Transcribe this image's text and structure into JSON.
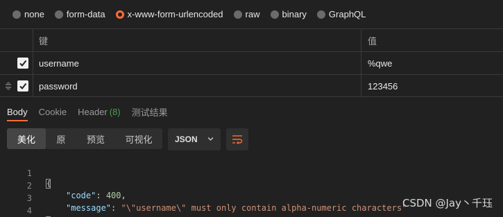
{
  "body_types": [
    {
      "label": "none",
      "selected": false
    },
    {
      "label": "form-data",
      "selected": false
    },
    {
      "label": "x-www-form-urlencoded",
      "selected": true
    },
    {
      "label": "raw",
      "selected": false
    },
    {
      "label": "binary",
      "selected": false
    },
    {
      "label": "GraphQL",
      "selected": false
    }
  ],
  "params_table": {
    "headers": {
      "key": "键",
      "value": "值"
    },
    "rows": [
      {
        "key": "username",
        "value": "%qwe",
        "checked": true
      },
      {
        "key": "password",
        "value": "123456",
        "checked": true
      }
    ]
  },
  "response_tabs": {
    "body": "Body",
    "cookie": "Cookie",
    "headers": "Header",
    "headers_count": "(8)",
    "tests": "测试结果"
  },
  "view_modes": [
    "美化",
    "原",
    "预览",
    "可视化"
  ],
  "active_view_mode": "美化",
  "format_select": {
    "value": "JSON"
  },
  "code": {
    "line_numbers": [
      "1",
      "2",
      "3",
      "4"
    ],
    "open_brace": "{",
    "close_brace": "}",
    "code_key": "\"code\"",
    "code_value": "400",
    "message_key": "\"message\"",
    "message_value": "\"\\\"username\\\" must only contain alpha-numeric characters\""
  },
  "watermark": "CSDN @Jay丶千珏",
  "colors": {
    "accent": "#ff6c37",
    "count_green": "#49a44c",
    "background": "#212121"
  }
}
